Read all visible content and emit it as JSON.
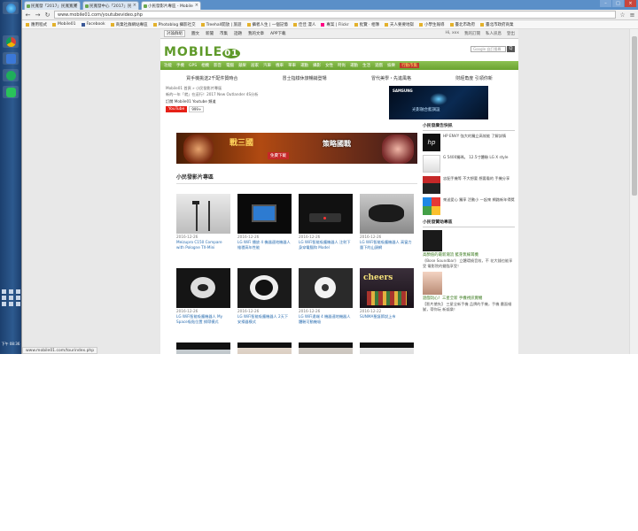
{
  "taskbar": {
    "clock": "下午 08:36"
  },
  "browser": {
    "tabs": [
      {
        "label": "民寬發「2017」民寬寬寬"
      },
      {
        "label": "民寬發中心「2017」民"
      },
      {
        "label": "小民發影片專區 - Mobile"
      }
    ],
    "url": "www.mobile01.com/youtubevideo.php",
    "bookmarks": [
      {
        "label": "應用程式"
      },
      {
        "label": "Mobile01"
      },
      {
        "label": "Facebook"
      },
      {
        "label": "商業社群網站專區"
      },
      {
        "label": "Photoblog 攝影社交"
      },
      {
        "label": "Treehall開放 | 旅遊"
      },
      {
        "label": "攝者人生 | 一個記憶"
      },
      {
        "label": "佳佳 漫人"
      },
      {
        "label": "專案 | Flickr"
      },
      {
        "label": "批覽 · 相簿"
      },
      {
        "label": "天人要要地獄"
      },
      {
        "label": "小學生報導"
      },
      {
        "label": "臺北市政府"
      },
      {
        "label": "臺北市政府商業"
      }
    ],
    "status_url": "www.mobile01.com/tourindex.php"
  },
  "site": {
    "topnav": [
      "討論群組",
      "圖文",
      "新聞",
      "市集",
      "話題",
      "我的文章",
      "APP下載"
    ],
    "topnav_right": [
      "Hi, xxx",
      "我的訂閱",
      "私人訊息",
      "登出"
    ],
    "logo": "MOBILE",
    "logo_suffix": "01",
    "search_placeholder": "Google 自訂搜尋",
    "search_btn": "Q",
    "catnav": [
      "功能",
      "手機",
      "GPS",
      "相機",
      "影音",
      "電腦",
      "蘋果",
      "居家",
      "汽車",
      "機車",
      "單車",
      "運動",
      "攝影",
      "女性",
      "時尚",
      "運動",
      "生活",
      "遊戲",
      "娛樂",
      "行動市集"
    ],
    "promos": [
      "買手機挑送2千配件贊時合",
      "冒士指樣休旅暢銷登場",
      "冒代美學・先進風格",
      "財經角度 引領你新"
    ],
    "breadcrumb_line1": "Mobile01 首頁 » 小民發影片專區",
    "breadcrumb_line2": "新的一年「就」在這行！2017 New Outlander 4S分析",
    "yt_label": "訂閱 Mobile01 Youtube 頻道",
    "yt_button": "YouTube",
    "yt_count": "999+",
    "ad_top": {
      "brand": "SAMSUNG",
      "caption": "光影融合藍調設"
    },
    "banner": {
      "title_a": "戰三國",
      "chip": "免費下載",
      "title_b": "策略國戰"
    },
    "section_title": "小民發影片專區",
    "videos": [
      {
        "date": "2016-12-26",
        "title": "Meizupro C150 Compare with Pologne TX-Mini"
      },
      {
        "date": "2016-12-26",
        "title": "LG WiFi 播放 4 機器速地機器人 維穩高年性能"
      },
      {
        "date": "2016-12-26",
        "title": "LG WiFi智能吸塵機器人 注射下 身穿電腦和 Model"
      },
      {
        "date": "2016-12-26",
        "title": "LG WiFi智能吸塵機器人 高窗力 量下的山頭網"
      },
      {
        "date": "2016-12-26",
        "title": "LG WiFi智能吸塵機器人 My Space吸貼位置 掃帶模式"
      },
      {
        "date": "2016-12-26",
        "title": "LG WiFi智能吸塵機器人 2天下 安掃器模式"
      },
      {
        "date": "2016-12-26",
        "title": "LG WiFi遠端 4 機器速地機器人 體驗可動機吸"
      },
      {
        "date": "2016-12-22",
        "title": "SUNMA聖誕節說上市"
      },
      {
        "date": "",
        "title": ""
      },
      {
        "date": "",
        "title": ""
      },
      {
        "date": "",
        "title": ""
      },
      {
        "date": "",
        "title": ""
      }
    ],
    "sidebar": {
      "title1": "小民發廣告快訊",
      "ads": [
        {
          "text": "HP ENVY 強大的獨立高效能 了解詳情"
        },
        {
          "text": "G 5400獨瑪。 12.5寸體驗 LG X style"
        },
        {
          "text": "忠配手機等 不大想要 想要看的 手機分享"
        },
        {
          "text": "來送愛心 獨享 活動小 一起來 網路新年得獎"
        }
      ],
      "title2": "小民發贊助專區",
      "feature1_title": "高顏值的最新潮流 藍芽無線耳機",
      "feature1_text": "《Bose Soundbar》 立體環繞音效，不 花大錢也能享受 電影院的聲臨享受！",
      "feature2_title": "遊戲玩心！三星全新 手機視訊實機",
      "feature2_text": "【影片搶先】 三星全新手機 品牌的手機，手機 畫面細膩，帶你玩 新娛樂！"
    }
  }
}
